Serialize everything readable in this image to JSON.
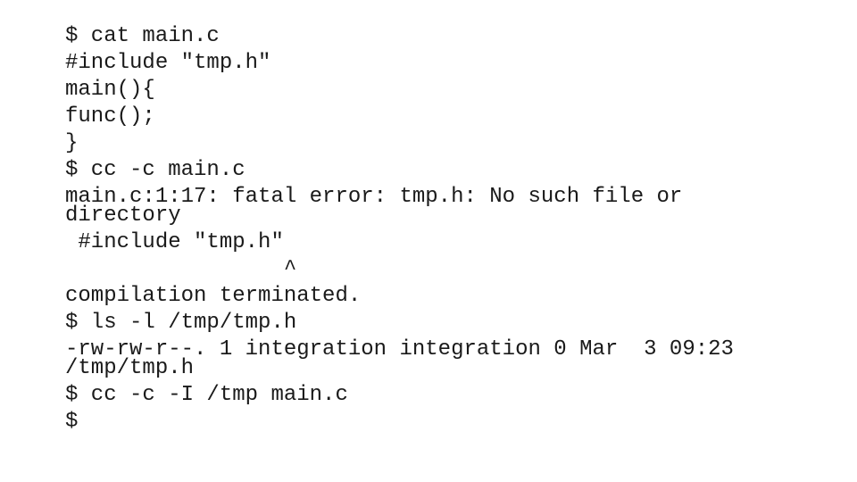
{
  "terminal": {
    "lines": [
      "$ cat main.c",
      "#include \"tmp.h\"",
      "main(){",
      "func();",
      "}",
      "$ cc -c main.c",
      "main.c:1:17: fatal error: tmp.h: No such file or",
      "directory",
      " #include \"tmp.h\"",
      "                 ^",
      "compilation terminated.",
      "$ ls -l /tmp/tmp.h",
      "-rw-rw-r--. 1 integration integration 0 Mar  3 09:23",
      "/tmp/tmp.h",
      "$ cc -c -I /tmp main.c",
      "$"
    ]
  }
}
